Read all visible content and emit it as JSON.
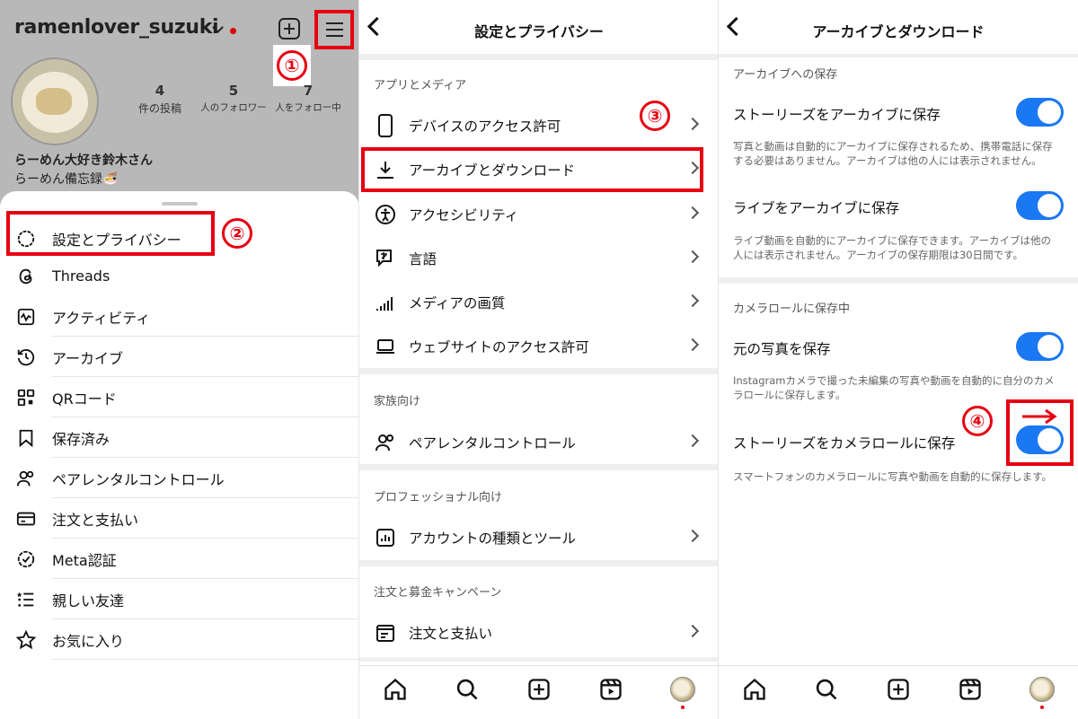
{
  "colors": {
    "accent_red": "#e60012",
    "toggle_blue": "#1a78f2",
    "band_gray": "#efefef"
  },
  "panel1": {
    "username": "ramenlover_suzuki",
    "stats": [
      {
        "num": "4",
        "label": "件の投稿"
      },
      {
        "num": "5",
        "label": "人のフォロワー"
      },
      {
        "num": "7",
        "label": "人をフォロー中"
      }
    ],
    "bio_name": "らーめん大好き鈴木さん",
    "bio_text": "らーめん備忘録🍜",
    "badge": "①",
    "badge2": "②",
    "menu": [
      {
        "label": "設定とプライバシー",
        "icon": "settings-gear-icon"
      },
      {
        "label": "Threads",
        "icon": "threads-icon"
      },
      {
        "label": "アクティビティ",
        "icon": "activity-icon"
      },
      {
        "label": "アーカイブ",
        "icon": "archive-history-icon"
      },
      {
        "label": "QRコード",
        "icon": "qr-code-icon"
      },
      {
        "label": "保存済み",
        "icon": "bookmark-icon"
      },
      {
        "label": "ペアレンタルコントロール",
        "icon": "parental-icon"
      },
      {
        "label": "注文と支払い",
        "icon": "card-icon"
      },
      {
        "label": "Meta認証",
        "icon": "verified-icon"
      },
      {
        "label": "親しい友達",
        "icon": "close-friends-icon"
      },
      {
        "label": "お気に入り",
        "icon": "star-icon"
      }
    ]
  },
  "panel2": {
    "title": "設定とプライバシー",
    "badge": "③",
    "sections": {
      "apps_media": "アプリとメディア",
      "family": "家族向け",
      "professional": "プロフェッショナル向け",
      "orders": "注文と募金キャンペーン"
    },
    "items": [
      {
        "label": "デバイスのアクセス許可",
        "icon": "phone-icon"
      },
      {
        "label": "アーカイブとダウンロード",
        "icon": "download-icon"
      },
      {
        "label": "アクセシビリティ",
        "icon": "accessibility-icon"
      },
      {
        "label": "言語",
        "icon": "language-icon"
      },
      {
        "label": "メディアの画質",
        "icon": "signal-icon"
      },
      {
        "label": "ウェブサイトのアクセス許可",
        "icon": "laptop-icon"
      },
      {
        "label": "ペアレンタルコントロール",
        "icon": "parental-icon"
      },
      {
        "label": "アカウントの種類とツール",
        "icon": "chart-icon"
      },
      {
        "label": "注文と支払い",
        "icon": "receipt-icon"
      }
    ]
  },
  "panel3": {
    "title": "アーカイブとダウンロード",
    "badge": "④",
    "sections": {
      "archive": "アーカイブへの保存",
      "camera_roll": "カメラロールに保存中"
    },
    "settings": [
      {
        "label": "ストーリーズをアーカイブに保存",
        "desc": "写真と動画は自動的にアーカイブに保存されるため、携帯電話に保存する必要はありません。アーカイブは他の人には表示されません。",
        "enabled": true
      },
      {
        "label": "ライブをアーカイブに保存",
        "desc": "ライブ動画を自動的にアーカイブに保存できます。アーカイブは他の人には表示されません。アーカイブの保存期限は30日間です。",
        "enabled": true
      },
      {
        "label": "元の写真を保存",
        "desc": "Instagramカメラで撮った未編集の写真や動画を自動的に自分のカメラロールに保存します。",
        "enabled": true
      },
      {
        "label": "ストーリーズをカメラロールに保存",
        "desc": "スマートフォンのカメラロールに写真や動画を自動的に保存します。",
        "enabled": true
      }
    ]
  },
  "tabbar": [
    "home-icon",
    "search-icon",
    "create-icon",
    "reels-icon",
    "profile-avatar"
  ]
}
